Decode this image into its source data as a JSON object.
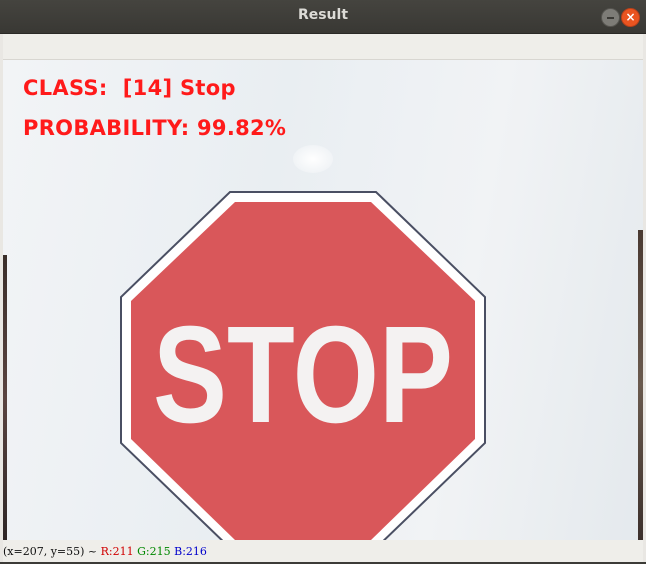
{
  "window": {
    "title": "Result",
    "minimize_symbol": "",
    "close_symbol": "×"
  },
  "overlay": {
    "class_text": "CLASS:  [14] Stop",
    "probability_text": "PROBABILITY: 99.82%",
    "text_color": "#ff1a1a"
  },
  "image": {
    "sign_text": "STOP",
    "sign_color": "#d9575a"
  },
  "status": {
    "coords": "(x=207, y=55) ~ ",
    "r": "R:211",
    "g": "G:215",
    "b": "B:216"
  }
}
